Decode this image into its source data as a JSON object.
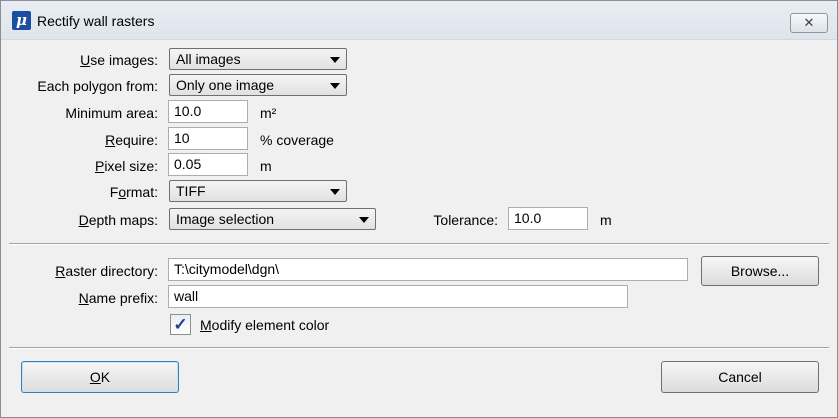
{
  "window": {
    "title": "Rectify wall rasters",
    "app_icon_glyph": "μ",
    "close_glyph": "✕"
  },
  "form": {
    "use_images": {
      "label_key": "U",
      "label_rest": "se images:",
      "value": "All images"
    },
    "each_polygon": {
      "label": "Each polygon from:",
      "value": "Only one image"
    },
    "minimum_area": {
      "label": "Minimum area:",
      "value": "10.0",
      "unit": "m²"
    },
    "require": {
      "label_key": "R",
      "label_rest": "equire:",
      "value": "10",
      "unit": "% coverage"
    },
    "pixel_size": {
      "label_key": "P",
      "label_rest": "ixel size:",
      "value": "0.05",
      "unit": "m"
    },
    "format": {
      "label_pre": "F",
      "label_key": "o",
      "label_rest": "rmat:",
      "value": "TIFF"
    },
    "depth_maps": {
      "label_key": "D",
      "label_rest": "epth maps:",
      "value": "Image selection"
    },
    "tolerance": {
      "label": "Tolerance:",
      "value": "10.0",
      "unit": "m"
    },
    "raster_directory": {
      "label_key": "R",
      "label_rest": "aster directory:",
      "value": "T:\\citymodel\\dgn\\"
    },
    "browse_label": "Browse...",
    "name_prefix": {
      "label_key": "N",
      "label_rest": "ame prefix:",
      "value": "wall"
    },
    "modify_color": {
      "label_key": "M",
      "label_rest": "odify element color",
      "checked": true
    }
  },
  "buttons": {
    "ok_key": "O",
    "ok_rest": "K",
    "cancel": "Cancel"
  }
}
